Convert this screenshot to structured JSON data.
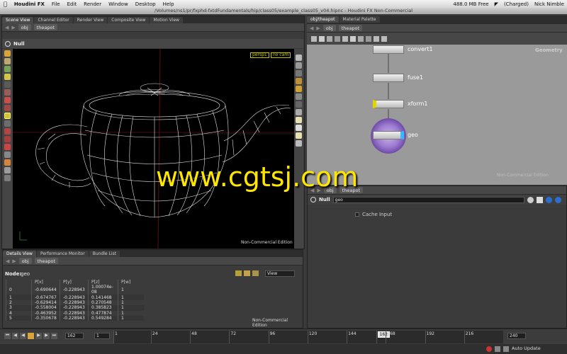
{
  "menubar": {
    "app_name": "Houdini FX",
    "items": [
      "File",
      "Edit",
      "Render",
      "Window",
      "Desktop",
      "Help"
    ],
    "window_title": "/Volumes/ns1/pr/fxphd-fxtdFundamentals/hip/class05/example_class05_v04.hipnc - Houdini FX Non-Commercial",
    "memory": "488.0 MB Free",
    "battery": "(Charged)",
    "user": "Nick Nimble"
  },
  "left_pane": {
    "tabs": [
      "Scene View",
      "Channel Editor",
      "Render View",
      "Composite View",
      "Motion View"
    ],
    "path": {
      "root": "obj",
      "node": "theapot"
    },
    "operator": "Null",
    "camera_menu": "persp1",
    "cam_menu": "no cam",
    "watermark": "Non-Commercial Edition"
  },
  "details": {
    "tabs": [
      "Details View",
      "Performance Monitor",
      "Bundle List"
    ],
    "path": {
      "root": "obj",
      "node": "theapot"
    },
    "node_label": "Node:",
    "node_value": "geo",
    "view_menu": "View",
    "columns": [
      "",
      "P[x]",
      "P[y]",
      "P[z]",
      "P[w]"
    ],
    "rows": [
      [
        "0",
        "-0.690644",
        "-0.228943",
        "1.00074e-08",
        "1"
      ],
      [
        "1",
        "-0.674767",
        "-0.228943",
        "0.141468",
        "1"
      ],
      [
        "2",
        "-0.629414",
        "-0.228943",
        "0.270548",
        "1"
      ],
      [
        "3",
        "-0.558004",
        "-0.228943",
        "0.385823",
        "1"
      ],
      [
        "4",
        "-0.463952",
        "-0.228943",
        "0.477874",
        "1"
      ],
      [
        "5",
        "-0.350678",
        "-0.228943",
        "0.549284",
        "1"
      ]
    ],
    "watermark": "Non-Commercial Edition"
  },
  "network": {
    "tabs": [
      "obj/theapot",
      "Material Palette"
    ],
    "path": {
      "root": "obj",
      "node": "theapot"
    },
    "context_label": "Geometry",
    "nodes": [
      "convert1",
      "fuse1",
      "xform1",
      "geo"
    ],
    "watermark": "Non-Commercial Edition"
  },
  "params": {
    "path": {
      "root": "obj",
      "node": "theapot"
    },
    "operator": "Null",
    "node_name": "geo",
    "cache_input_label": "Cache Input",
    "cache_input_checked": false
  },
  "timeline": {
    "current_frame": "162",
    "start_frame": "1",
    "end_frame": "240",
    "ticks": [
      "1",
      "24",
      "48",
      "72",
      "96",
      "120",
      "144",
      "162",
      "168",
      "192",
      "216"
    ],
    "playhead_label": "162"
  },
  "statusbar": {
    "auto_update": "Auto Update"
  },
  "overlay": {
    "watermark_url": "www.cgtsj.com"
  },
  "colors": {
    "viewport_bg": "#000000",
    "wire": "#e6e6e6",
    "network_bg": "#9a9a9a",
    "display_flag": "#39b7ff",
    "template_flag": "#e6d400",
    "watermark_yellow": "#ffe600"
  }
}
